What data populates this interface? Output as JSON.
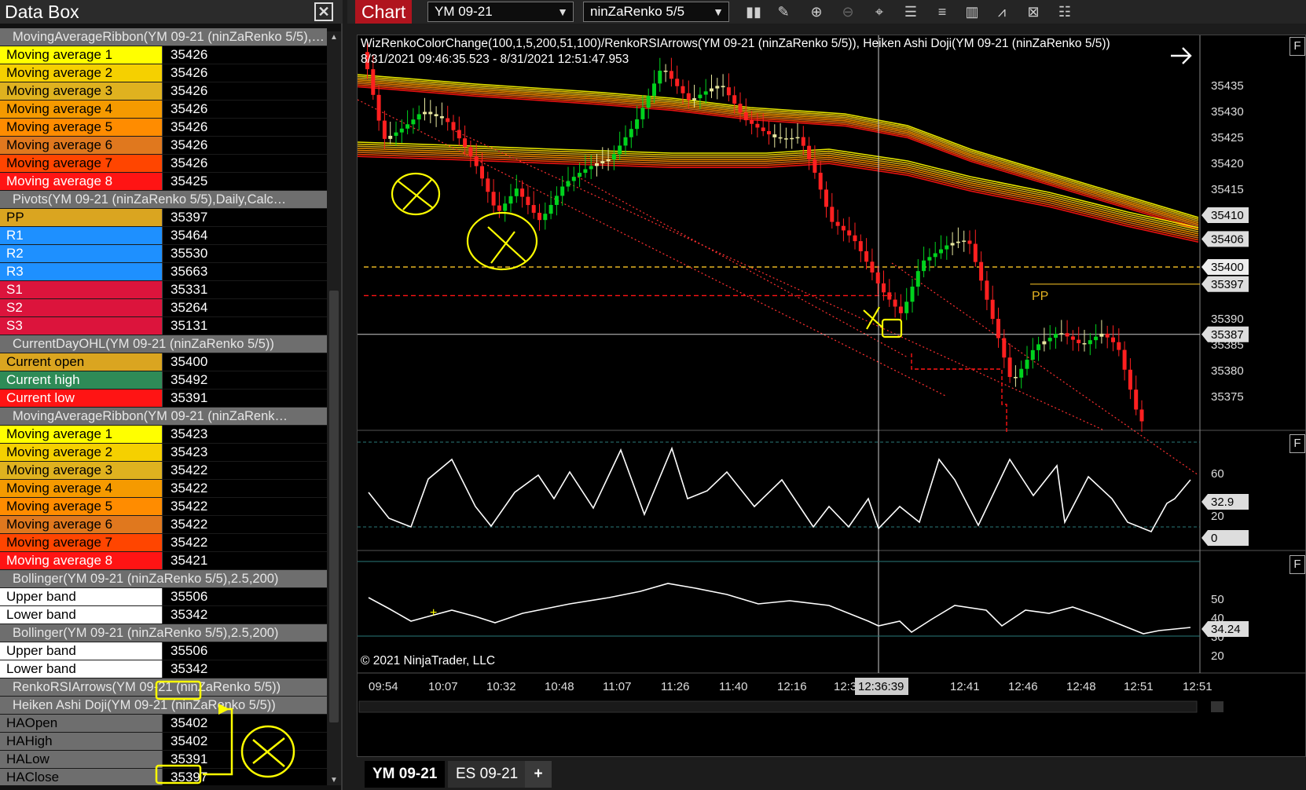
{
  "databox": {
    "title": "Data Box",
    "close": "✕",
    "rows": [
      {
        "t": "h",
        "text": "MovingAverageRibbon(YM 09-21 (ninZaRenko 5/5),…"
      },
      {
        "label": "Moving average 1",
        "value": "35426",
        "bg": "#ffff00",
        "fg": "#000"
      },
      {
        "label": "Moving average 2",
        "value": "35426",
        "bg": "#f5d000",
        "fg": "#000"
      },
      {
        "label": "Moving average 3",
        "value": "35426",
        "bg": "#dfb21f",
        "fg": "#000"
      },
      {
        "label": "Moving average 4",
        "value": "35426",
        "bg": "#f59a00",
        "fg": "#000"
      },
      {
        "label": "Moving average 5",
        "value": "35426",
        "bg": "#ff8c00",
        "fg": "#000"
      },
      {
        "label": "Moving average 6",
        "value": "35426",
        "bg": "#e0781e",
        "fg": "#000"
      },
      {
        "label": "Moving average 7",
        "value": "35426",
        "bg": "#ff4500",
        "fg": "#000"
      },
      {
        "label": "Moving average 8",
        "value": "35425",
        "bg": "#ff1414",
        "fg": "#fff"
      },
      {
        "t": "h",
        "text": "Pivots(YM 09-21 (ninZaRenko 5/5),Daily,Calc…"
      },
      {
        "label": "PP",
        "value": "35397",
        "bg": "#daa520",
        "fg": "#000"
      },
      {
        "label": "R1",
        "value": "35464",
        "bg": "#1e90ff",
        "fg": "#fff"
      },
      {
        "label": "R2",
        "value": "35530",
        "bg": "#1e90ff",
        "fg": "#fff"
      },
      {
        "label": "R3",
        "value": "35663",
        "bg": "#1e90ff",
        "fg": "#fff"
      },
      {
        "label": "S1",
        "value": "35331",
        "bg": "#dc143c",
        "fg": "#fff"
      },
      {
        "label": "S2",
        "value": "35264",
        "bg": "#dc143c",
        "fg": "#fff"
      },
      {
        "label": "S3",
        "value": "35131",
        "bg": "#dc143c",
        "fg": "#fff"
      },
      {
        "t": "h",
        "text": "CurrentDayOHL(YM 09-21 (ninZaRenko 5/5))"
      },
      {
        "label": "Current open",
        "value": "35400",
        "bg": "#daa520",
        "fg": "#000"
      },
      {
        "label": "Current high",
        "value": "35492",
        "bg": "#2e8b57",
        "fg": "#fff"
      },
      {
        "label": "Current low",
        "value": "35391",
        "bg": "#ff1414",
        "fg": "#fff"
      },
      {
        "t": "h",
        "text": "MovingAverageRibbon(YM 09-21 (ninZaRenk…"
      },
      {
        "label": "Moving average 1",
        "value": "35423",
        "bg": "#ffff00",
        "fg": "#000"
      },
      {
        "label": "Moving average 2",
        "value": "35423",
        "bg": "#f5d000",
        "fg": "#000"
      },
      {
        "label": "Moving average 3",
        "value": "35422",
        "bg": "#dfb21f",
        "fg": "#000"
      },
      {
        "label": "Moving average 4",
        "value": "35422",
        "bg": "#f59a00",
        "fg": "#000"
      },
      {
        "label": "Moving average 5",
        "value": "35422",
        "bg": "#ff8c00",
        "fg": "#000"
      },
      {
        "label": "Moving average 6",
        "value": "35422",
        "bg": "#e0781e",
        "fg": "#000"
      },
      {
        "label": "Moving average 7",
        "value": "35422",
        "bg": "#ff4500",
        "fg": "#000"
      },
      {
        "label": "Moving average 8",
        "value": "35421",
        "bg": "#ff1414",
        "fg": "#fff"
      },
      {
        "t": "h",
        "text": "Bollinger(YM 09-21 (ninZaRenko 5/5),2.5,200)"
      },
      {
        "label": "Upper band",
        "value": "35506",
        "bg": "#ffffff",
        "fg": "#000"
      },
      {
        "label": "Lower band",
        "value": "35342",
        "bg": "#ffffff",
        "fg": "#000"
      },
      {
        "t": "h",
        "text": "Bollinger(YM 09-21 (ninZaRenko 5/5),2.5,200)"
      },
      {
        "label": "Upper band",
        "value": "35506",
        "bg": "#ffffff",
        "fg": "#000"
      },
      {
        "label": "Lower band",
        "value": "35342",
        "bg": "#ffffff",
        "fg": "#000"
      },
      {
        "t": "h",
        "text": "RenkoRSIArrows(YM 09-21 (ninZaRenko 5/5))"
      },
      {
        "t": "h",
        "text": "Heiken Ashi Doji(YM 09-21 (ninZaRenko 5/5))"
      },
      {
        "label": "HAOpen",
        "value": "35402",
        "bg": "#6e6e6e",
        "fg": "#000"
      },
      {
        "label": "HAHigh",
        "value": "35402",
        "bg": "#6e6e6e",
        "fg": "#000"
      },
      {
        "label": "HALow",
        "value": "35391",
        "bg": "#6e6e6e",
        "fg": "#000"
      },
      {
        "label": "HAClose",
        "value": "35397",
        "bg": "#6e6e6e",
        "fg": "#000"
      }
    ]
  },
  "chart": {
    "title": "Chart",
    "instrument": "YM 09-21",
    "bartype": "ninZaRenko 5/5",
    "toolbar_icons": [
      "bar-type-icon",
      "draw-pencil-icon",
      "zoom-in-icon",
      "zoom-out-icon",
      "crosshair-icon",
      "data-box-icon",
      "properties-icon",
      "indicators-icon",
      "strategies-icon",
      "drawing-objects-icon",
      "templates-icon"
    ],
    "info_line1": "WizRenkoColorChange(100,1,5,200,51,100)/RenkoRSIArrows(YM 09-21 (ninZaRenko 5/5)), Heiken Ashi Doji(YM 09-21 (ninZaRenko 5/5))",
    "info_line2": "8/31/2021 09:46:35.523 - 8/31/2021 12:51:47.953",
    "copyright": "© 2021 NinjaTrader, LLC",
    "fbutton": "F",
    "price_ticks": [
      "35435",
      "35430",
      "35425",
      "35420",
      "35415",
      "35410",
      "35406",
      "35400",
      "35397",
      "35390",
      "35387",
      "35385",
      "35380",
      "35375"
    ],
    "pivot_label": "PP",
    "rsi_ticks": [
      "60",
      "32.9",
      "20",
      "0"
    ],
    "cci_ticks": [
      "50",
      "40",
      "34.24",
      "30",
      "20"
    ],
    "time_labels": [
      "09:54",
      "10:07",
      "10:32",
      "10:48",
      "11:07",
      "11:26",
      "11:40",
      "12:16",
      "12:32",
      "12:36:39",
      "12:41",
      "12:46",
      "12:48",
      "12:51",
      "12:51"
    ],
    "tabs": [
      "YM 09-21",
      "ES 09-21",
      "+"
    ],
    "colors": {
      "up": "#00d21e",
      "down": "#ff2020",
      "doji": "#e8e8a0",
      "pp": "#e6b422",
      "s1": "#ff2020",
      "annot": "#ffff00"
    },
    "chart_data": {
      "type": "line",
      "instrument": "YM 09-21",
      "price_range": [
        35370,
        35440
      ],
      "pivot_pp": 35397,
      "current_open": 35400,
      "crosshair_time": "12:36:39",
      "crosshair_price": 35387,
      "rsi_last": 32.9,
      "cci_last": 34.24
    }
  }
}
